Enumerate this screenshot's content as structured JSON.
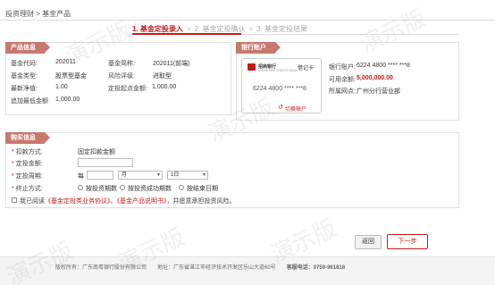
{
  "breadcrumb": "投资理财 > 基金产品",
  "steps": [
    {
      "label": "1. 基金定投录入",
      "active": true
    },
    {
      "label": "2. 基金定投确认",
      "active": false
    },
    {
      "label": "3. 基金定投结果",
      "active": false
    }
  ],
  "step_sep": ">",
  "product": {
    "title": "产品信息",
    "fund_code_label": "基金代码:",
    "fund_code": "202011",
    "fund_abbr_label": "基金简称:",
    "fund_abbr": "202011(前端)",
    "fund_type_label": "基金类型:",
    "fund_type": "股票型基金",
    "risk_label": "风险评级:",
    "risk": "进取型",
    "nav_label": "最新净值:",
    "nav": "1.00",
    "min_start_label": "定投起点金额:",
    "min_start": "1,000.00",
    "min_add_label": "追加最低金额",
    "min_add": "1,000.00"
  },
  "bank": {
    "title": "银行账户",
    "card_bank_name": "招商银行",
    "card_bank_sub": "CHINA MERCHANTS BANK",
    "card_type": "借记卡",
    "card_number": "6224 4800 **** ***8",
    "switch_label": "切换账户",
    "account_label": "银行账户:",
    "account": "6224 4800 **** ***8",
    "balance_label": "可用余额:",
    "balance": "5,000,000.00",
    "branch_label": "所属网点:",
    "branch": "广州分行营业部"
  },
  "purchase": {
    "title": "购买信息",
    "method_label": "扣款方式:",
    "method": "固定扣款金额",
    "amount_label": "定投金额:",
    "period_label": "定投周期:",
    "period_prefix": "每",
    "month_option": "月",
    "day_option": "1日",
    "stop_label": "终止方式:",
    "stop_options": [
      "按投资期数",
      "按投资成功期数",
      "按结束日期"
    ],
    "agree_prefix": "我已阅读",
    "agree_link1": "《基金定投类业务协议》",
    "agree_sep": "、",
    "agree_link2": "《基金产品说明书》",
    "agree_suffix": "，并愿意承担投资风险。"
  },
  "buttons": {
    "back": "返回",
    "next": "下一步"
  },
  "footer": {
    "copyright": "版权所有：广东南粤银行股份有限公司　　地址：广东省湛江市经济技术开发区乐山大道60号",
    "hotline_label": "客服电话：",
    "hotline": "0759-961818"
  },
  "watermark_text": "演示版",
  "colors": {
    "brand_red": "#c41a1a",
    "panel_tag": "#c8786d"
  }
}
